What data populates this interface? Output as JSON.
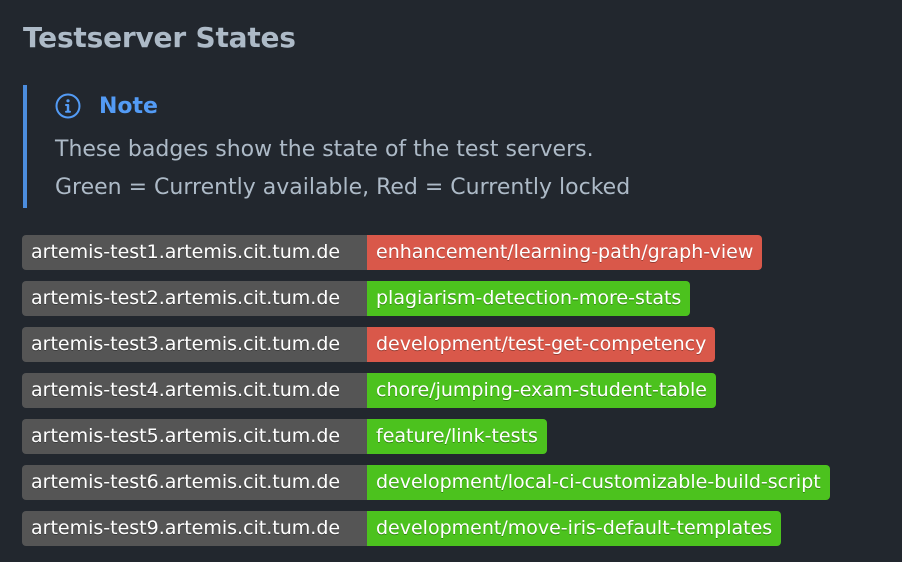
{
  "page": {
    "heading": "Testserver States"
  },
  "note": {
    "icon": "info-icon",
    "title": "Note",
    "lines": [
      "These badges show the state of the test servers.",
      "Green = Currently available, Red = Currently locked"
    ]
  },
  "colors": {
    "available": "#4cc21e",
    "locked": "#d9584a",
    "label_bg": "#555555",
    "accent": "#539bf5"
  },
  "badges": [
    {
      "server": "artemis-test1.artemis.cit.tum.de",
      "branch": "enhancement/learning-path/graph-view",
      "state": "locked"
    },
    {
      "server": "artemis-test2.artemis.cit.tum.de",
      "branch": "plagiarism-detection-more-stats",
      "state": "available"
    },
    {
      "server": "artemis-test3.artemis.cit.tum.de",
      "branch": "development/test-get-competency",
      "state": "locked"
    },
    {
      "server": "artemis-test4.artemis.cit.tum.de",
      "branch": "chore/jumping-exam-student-table",
      "state": "available"
    },
    {
      "server": "artemis-test5.artemis.cit.tum.de",
      "branch": "feature/link-tests",
      "state": "available"
    },
    {
      "server": "artemis-test6.artemis.cit.tum.de",
      "branch": "development/local-ci-customizable-build-script",
      "state": "available"
    },
    {
      "server": "artemis-test9.artemis.cit.tum.de",
      "branch": "development/move-iris-default-templates",
      "state": "available"
    }
  ]
}
